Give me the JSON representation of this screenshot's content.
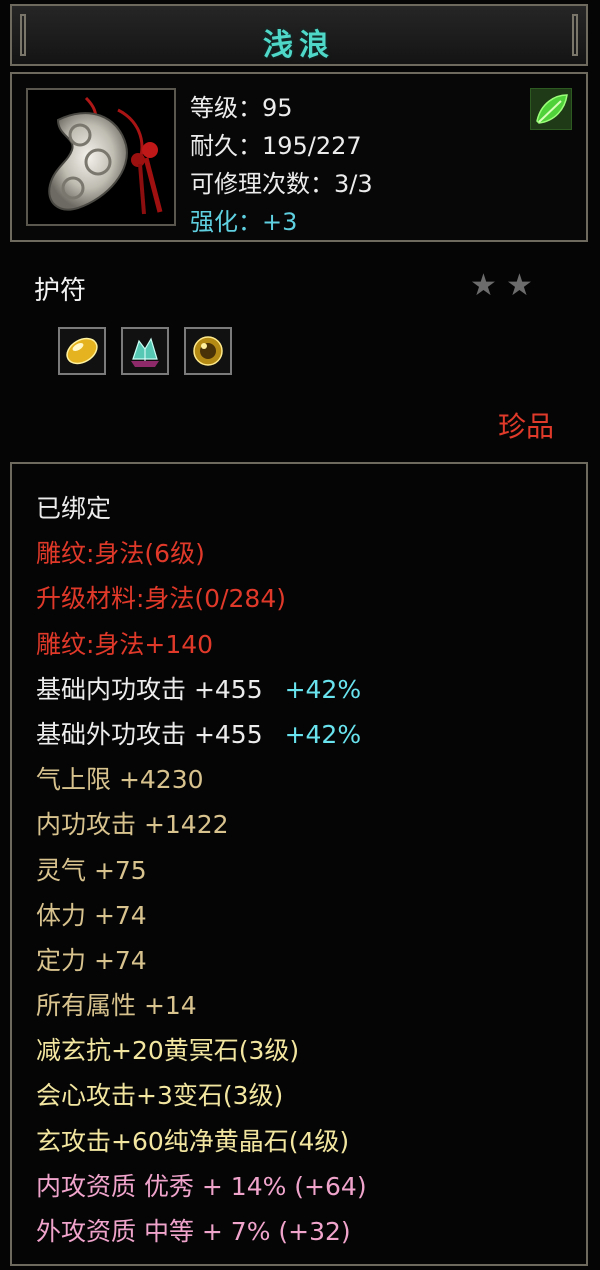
{
  "title": "浅浪",
  "item": {
    "level_label": "等级：95",
    "durability_label": "耐久：195/227",
    "repair_label": "可修理次数：3/3",
    "enhance_label": "强化：+3",
    "type": "护符",
    "rarity": "珍品",
    "stars": 2
  },
  "gem_icons": [
    "yellow-gem-icon",
    "crystal-gem-icon",
    "amber-gem-icon"
  ],
  "attributes": [
    {
      "text": "已绑定",
      "color": "#ececec"
    },
    {
      "text": "雕纹:身法(6级)",
      "color": "#e0392a"
    },
    {
      "text": "升级材料:身法(0/284)",
      "color": "#e0392a"
    },
    {
      "text": "雕纹:身法+140",
      "color": "#e0392a"
    },
    {
      "text": "基础内功攻击  +455",
      "extra": "+42%",
      "color": "#ececec"
    },
    {
      "text": "基础外功攻击  +455",
      "extra": "+42%",
      "color": "#ececec"
    },
    {
      "text": "气上限  +4230",
      "color": "#d8c28e"
    },
    {
      "text": "内功攻击  +1422",
      "color": "#d8c28e"
    },
    {
      "text": "灵气  +75",
      "color": "#d8c28e"
    },
    {
      "text": "体力  +74",
      "color": "#d8c28e"
    },
    {
      "text": "定力  +74",
      "color": "#d8c28e"
    },
    {
      "text": "所有属性  +14",
      "color": "#d8c28e"
    },
    {
      "text": "减玄抗+20黄冥石(3级)",
      "color": "#f2e6a0"
    },
    {
      "text": "会心攻击+3变石(3级)",
      "color": "#f2e6a0"
    },
    {
      "text": "玄攻击+60纯净黄晶石(4级)",
      "color": "#f2e6a0"
    },
    {
      "text": "内攻资质  优秀  +  14%  (+64)",
      "color": "#f0a4cc"
    },
    {
      "text": "外攻资质  中等  +  7%  (+32)",
      "color": "#f0a4cc"
    }
  ]
}
